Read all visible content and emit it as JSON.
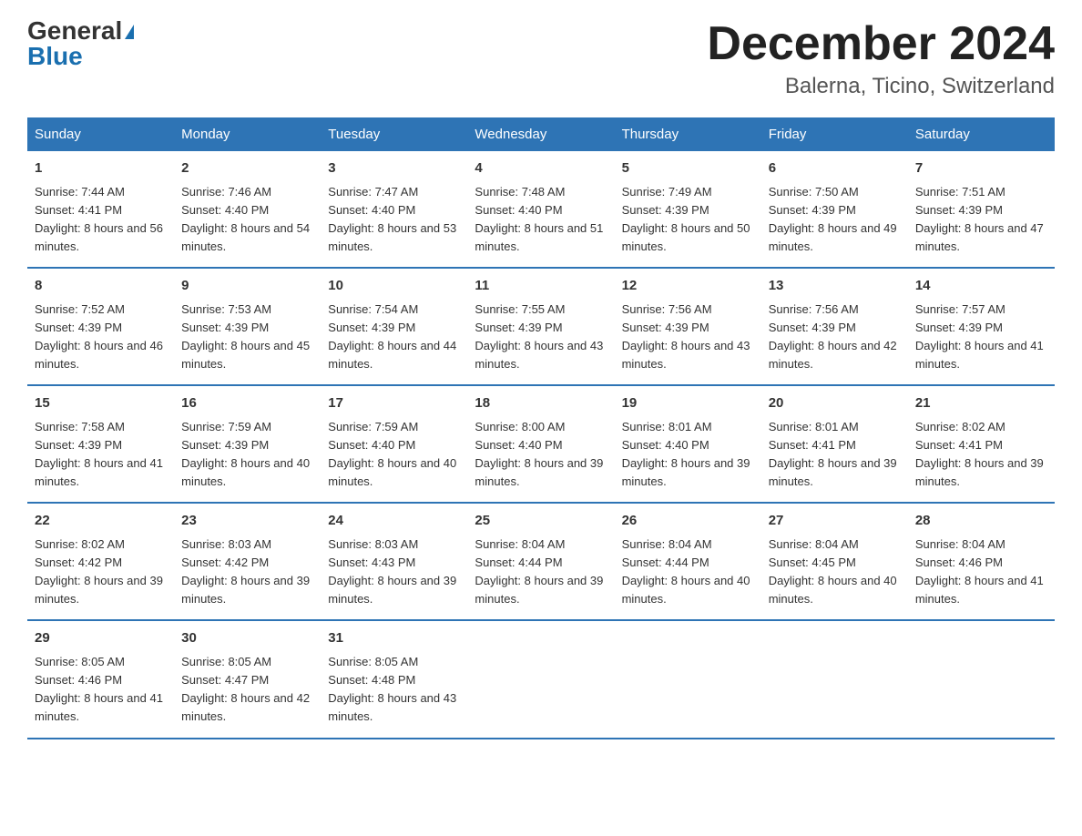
{
  "logo": {
    "general": "General",
    "blue": "Blue"
  },
  "title": "December 2024",
  "location": "Balerna, Ticino, Switzerland",
  "days_of_week": [
    "Sunday",
    "Monday",
    "Tuesday",
    "Wednesday",
    "Thursday",
    "Friday",
    "Saturday"
  ],
  "weeks": [
    [
      {
        "day": "1",
        "sunrise": "7:44 AM",
        "sunset": "4:41 PM",
        "daylight": "8 hours and 56 minutes."
      },
      {
        "day": "2",
        "sunrise": "7:46 AM",
        "sunset": "4:40 PM",
        "daylight": "8 hours and 54 minutes."
      },
      {
        "day": "3",
        "sunrise": "7:47 AM",
        "sunset": "4:40 PM",
        "daylight": "8 hours and 53 minutes."
      },
      {
        "day": "4",
        "sunrise": "7:48 AM",
        "sunset": "4:40 PM",
        "daylight": "8 hours and 51 minutes."
      },
      {
        "day": "5",
        "sunrise": "7:49 AM",
        "sunset": "4:39 PM",
        "daylight": "8 hours and 50 minutes."
      },
      {
        "day": "6",
        "sunrise": "7:50 AM",
        "sunset": "4:39 PM",
        "daylight": "8 hours and 49 minutes."
      },
      {
        "day": "7",
        "sunrise": "7:51 AM",
        "sunset": "4:39 PM",
        "daylight": "8 hours and 47 minutes."
      }
    ],
    [
      {
        "day": "8",
        "sunrise": "7:52 AM",
        "sunset": "4:39 PM",
        "daylight": "8 hours and 46 minutes."
      },
      {
        "day": "9",
        "sunrise": "7:53 AM",
        "sunset": "4:39 PM",
        "daylight": "8 hours and 45 minutes."
      },
      {
        "day": "10",
        "sunrise": "7:54 AM",
        "sunset": "4:39 PM",
        "daylight": "8 hours and 44 minutes."
      },
      {
        "day": "11",
        "sunrise": "7:55 AM",
        "sunset": "4:39 PM",
        "daylight": "8 hours and 43 minutes."
      },
      {
        "day": "12",
        "sunrise": "7:56 AM",
        "sunset": "4:39 PM",
        "daylight": "8 hours and 43 minutes."
      },
      {
        "day": "13",
        "sunrise": "7:56 AM",
        "sunset": "4:39 PM",
        "daylight": "8 hours and 42 minutes."
      },
      {
        "day": "14",
        "sunrise": "7:57 AM",
        "sunset": "4:39 PM",
        "daylight": "8 hours and 41 minutes."
      }
    ],
    [
      {
        "day": "15",
        "sunrise": "7:58 AM",
        "sunset": "4:39 PM",
        "daylight": "8 hours and 41 minutes."
      },
      {
        "day": "16",
        "sunrise": "7:59 AM",
        "sunset": "4:39 PM",
        "daylight": "8 hours and 40 minutes."
      },
      {
        "day": "17",
        "sunrise": "7:59 AM",
        "sunset": "4:40 PM",
        "daylight": "8 hours and 40 minutes."
      },
      {
        "day": "18",
        "sunrise": "8:00 AM",
        "sunset": "4:40 PM",
        "daylight": "8 hours and 39 minutes."
      },
      {
        "day": "19",
        "sunrise": "8:01 AM",
        "sunset": "4:40 PM",
        "daylight": "8 hours and 39 minutes."
      },
      {
        "day": "20",
        "sunrise": "8:01 AM",
        "sunset": "4:41 PM",
        "daylight": "8 hours and 39 minutes."
      },
      {
        "day": "21",
        "sunrise": "8:02 AM",
        "sunset": "4:41 PM",
        "daylight": "8 hours and 39 minutes."
      }
    ],
    [
      {
        "day": "22",
        "sunrise": "8:02 AM",
        "sunset": "4:42 PM",
        "daylight": "8 hours and 39 minutes."
      },
      {
        "day": "23",
        "sunrise": "8:03 AM",
        "sunset": "4:42 PM",
        "daylight": "8 hours and 39 minutes."
      },
      {
        "day": "24",
        "sunrise": "8:03 AM",
        "sunset": "4:43 PM",
        "daylight": "8 hours and 39 minutes."
      },
      {
        "day": "25",
        "sunrise": "8:04 AM",
        "sunset": "4:44 PM",
        "daylight": "8 hours and 39 minutes."
      },
      {
        "day": "26",
        "sunrise": "8:04 AM",
        "sunset": "4:44 PM",
        "daylight": "8 hours and 40 minutes."
      },
      {
        "day": "27",
        "sunrise": "8:04 AM",
        "sunset": "4:45 PM",
        "daylight": "8 hours and 40 minutes."
      },
      {
        "day": "28",
        "sunrise": "8:04 AM",
        "sunset": "4:46 PM",
        "daylight": "8 hours and 41 minutes."
      }
    ],
    [
      {
        "day": "29",
        "sunrise": "8:05 AM",
        "sunset": "4:46 PM",
        "daylight": "8 hours and 41 minutes."
      },
      {
        "day": "30",
        "sunrise": "8:05 AM",
        "sunset": "4:47 PM",
        "daylight": "8 hours and 42 minutes."
      },
      {
        "day": "31",
        "sunrise": "8:05 AM",
        "sunset": "4:48 PM",
        "daylight": "8 hours and 43 minutes."
      },
      {
        "day": "",
        "sunrise": "",
        "sunset": "",
        "daylight": ""
      },
      {
        "day": "",
        "sunrise": "",
        "sunset": "",
        "daylight": ""
      },
      {
        "day": "",
        "sunrise": "",
        "sunset": "",
        "daylight": ""
      },
      {
        "day": "",
        "sunrise": "",
        "sunset": "",
        "daylight": ""
      }
    ]
  ]
}
